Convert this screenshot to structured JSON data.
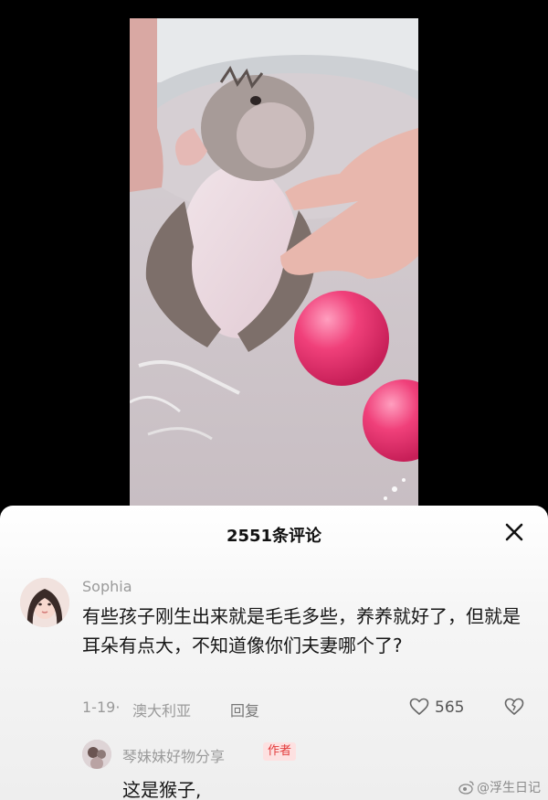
{
  "video": {
    "description_icon": "video-still-monkey-bath"
  },
  "comments_panel": {
    "count_title": "2551条评论",
    "close_icon": "close-icon"
  },
  "comment": {
    "username": "Sophia",
    "text": "有些孩子刚生出来就是毛毛多些，养养就好了，但就是耳朵有点大，不知道像你们夫妻哪个了?",
    "date": "1-19",
    "separator": "·",
    "location": "澳大利亚",
    "reply_label": "回复",
    "like_count": "565"
  },
  "reply": {
    "username": "琴妹妹好物分享",
    "badge": "作者",
    "text": "这是猴子,"
  },
  "watermark": {
    "text": "@浮生日记"
  },
  "colors": {
    "badge_red": "#e23c3c",
    "ball_pink": "#f0407a"
  }
}
